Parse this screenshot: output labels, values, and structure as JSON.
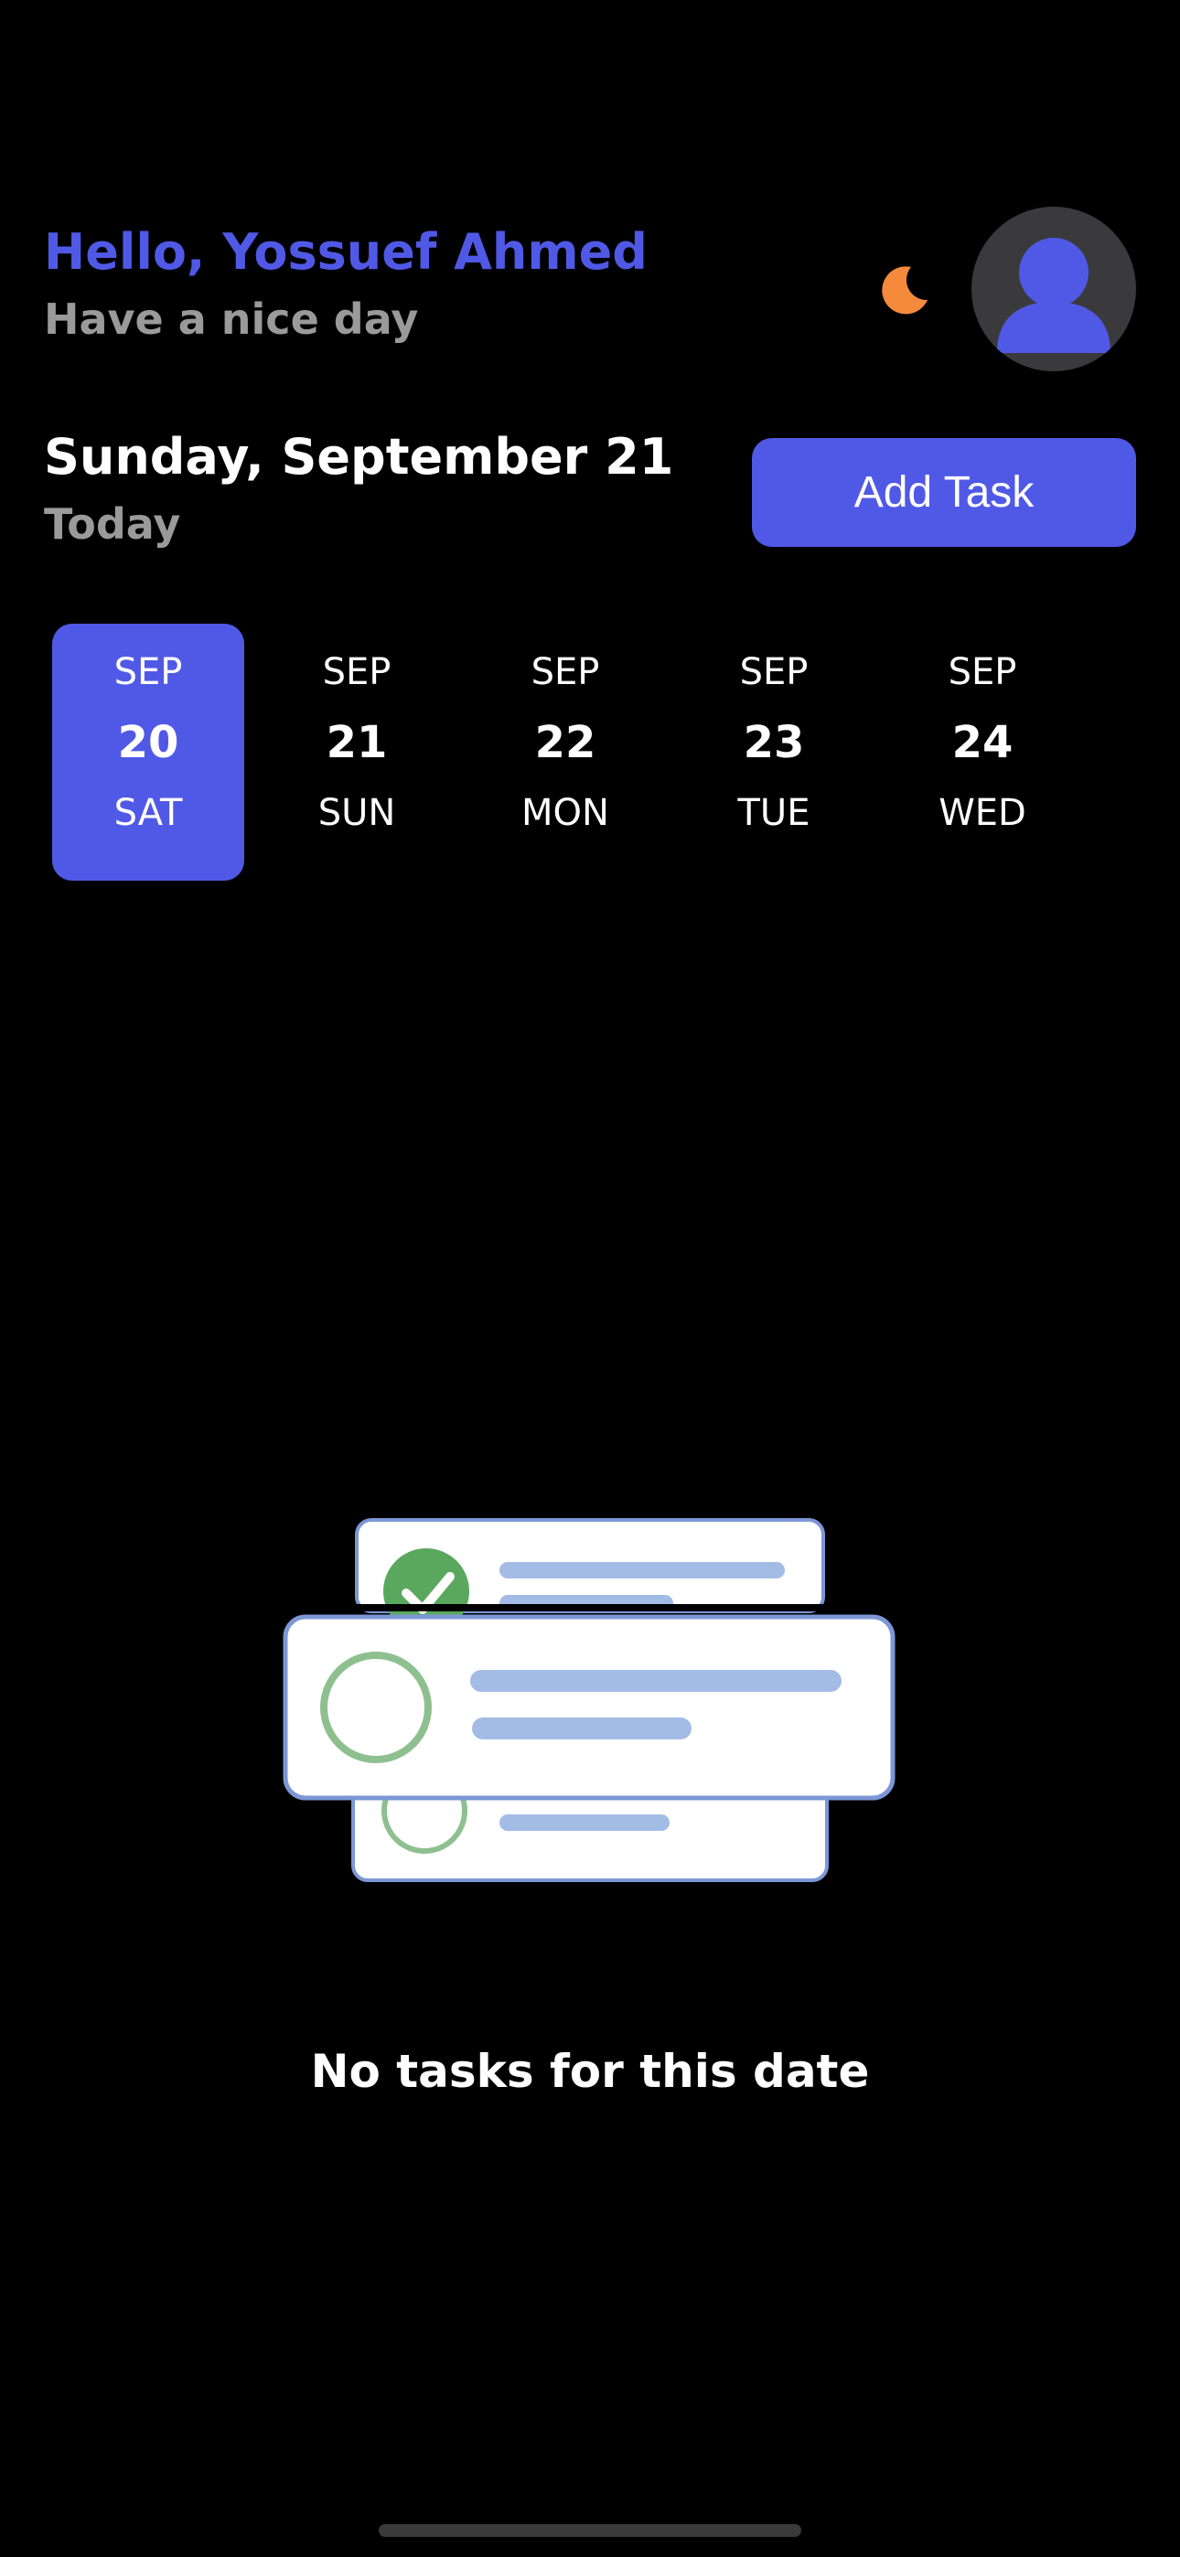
{
  "header": {
    "greeting": "Hello, Yossuef Ahmed",
    "subtitle": "Have a nice day",
    "theme_icon": "moon-icon",
    "avatar_icon": "user-avatar-icon"
  },
  "date_header": {
    "title": "Sunday, September 21",
    "subtitle": "Today",
    "add_task_label": "Add Task"
  },
  "date_strip": {
    "items": [
      {
        "month": "SEP",
        "day": "20",
        "weekday": "SAT",
        "selected": true
      },
      {
        "month": "SEP",
        "day": "21",
        "weekday": "SUN",
        "selected": false
      },
      {
        "month": "SEP",
        "day": "22",
        "weekday": "MON",
        "selected": false
      },
      {
        "month": "SEP",
        "day": "23",
        "weekday": "TUE",
        "selected": false
      },
      {
        "month": "SEP",
        "day": "24",
        "weekday": "WED",
        "selected": false
      }
    ]
  },
  "empty_state": {
    "icon": "task-list-illustration",
    "message": "No tasks for this date"
  },
  "colors": {
    "accent": "#5059e6",
    "background": "#000000",
    "muted_text": "#9a9a9a",
    "moon": "#f58a3c",
    "check_green": "#4caf50"
  }
}
